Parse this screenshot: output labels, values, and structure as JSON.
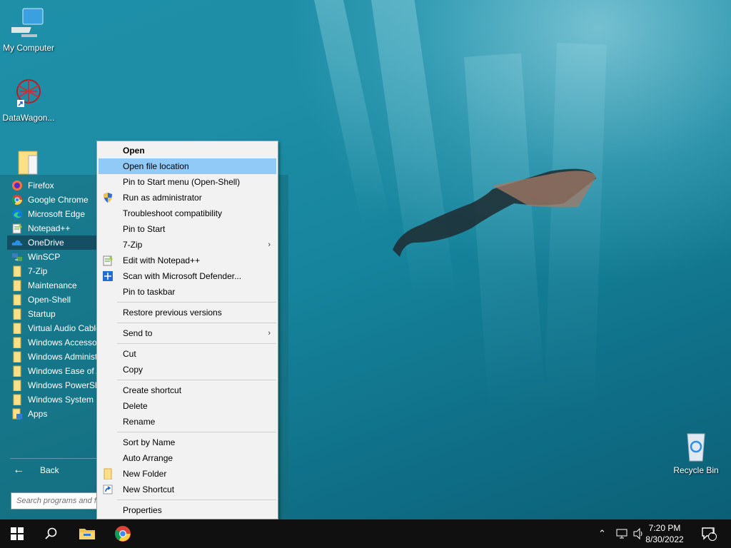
{
  "desktop": {
    "icons": [
      {
        "label": "My Computer"
      },
      {
        "label": "DataWagon..."
      },
      {
        "label": "Recycle Bin"
      }
    ]
  },
  "start_menu": {
    "programs": [
      {
        "label": "Firefox",
        "icon": "firefox-icon"
      },
      {
        "label": "Google Chrome",
        "icon": "chrome-icon"
      },
      {
        "label": "Microsoft Edge",
        "icon": "edge-icon"
      },
      {
        "label": "Notepad++",
        "icon": "notepadpp-icon"
      },
      {
        "label": "OneDrive",
        "icon": "onedrive-icon"
      },
      {
        "label": "WinSCP",
        "icon": "winscp-icon"
      },
      {
        "label": "7-Zip",
        "icon": "folder-icon"
      },
      {
        "label": "Maintenance",
        "icon": "folder-icon"
      },
      {
        "label": "Open-Shell",
        "icon": "folder-icon"
      },
      {
        "label": "Startup",
        "icon": "folder-icon"
      },
      {
        "label": "Virtual Audio Cable",
        "icon": "folder-icon"
      },
      {
        "label": "Windows Accessories",
        "icon": "folder-icon"
      },
      {
        "label": "Windows Administrative Tools",
        "icon": "folder-icon"
      },
      {
        "label": "Windows Ease of Access",
        "icon": "folder-icon"
      },
      {
        "label": "Windows PowerShell",
        "icon": "folder-icon"
      },
      {
        "label": "Windows System",
        "icon": "folder-icon"
      },
      {
        "label": "Apps",
        "icon": "apps-icon"
      }
    ],
    "back_label": "Back",
    "search_placeholder": "Search programs and files"
  },
  "context_menu": {
    "groups": [
      [
        {
          "label": "Open",
          "bold": true
        },
        {
          "label": "Open file location",
          "highlighted": true
        },
        {
          "label": "Pin to Start menu (Open-Shell)"
        },
        {
          "label": "Run as administrator",
          "icon": "uac-shield-icon"
        },
        {
          "label": "Troubleshoot compatibility"
        },
        {
          "label": "Pin to Start"
        },
        {
          "label": "7-Zip",
          "submenu": true
        },
        {
          "label": "Edit with Notepad++",
          "icon": "notepadpp-icon"
        },
        {
          "label": "Scan with Microsoft Defender...",
          "icon": "defender-icon"
        },
        {
          "label": "Pin to taskbar"
        }
      ],
      [
        {
          "label": "Restore previous versions"
        }
      ],
      [
        {
          "label": "Send to",
          "submenu": true
        }
      ],
      [
        {
          "label": "Cut"
        },
        {
          "label": "Copy"
        }
      ],
      [
        {
          "label": "Create shortcut"
        },
        {
          "label": "Delete"
        },
        {
          "label": "Rename"
        }
      ],
      [
        {
          "label": "Sort by Name"
        },
        {
          "label": "Auto Arrange"
        },
        {
          "label": "New Folder",
          "icon": "folder-icon"
        },
        {
          "label": "New Shortcut",
          "icon": "shortcut-icon"
        }
      ],
      [
        {
          "label": "Properties"
        }
      ]
    ]
  },
  "taskbar": {
    "time": "7:20 PM",
    "date": "8/30/2022",
    "notification_count": "1"
  }
}
